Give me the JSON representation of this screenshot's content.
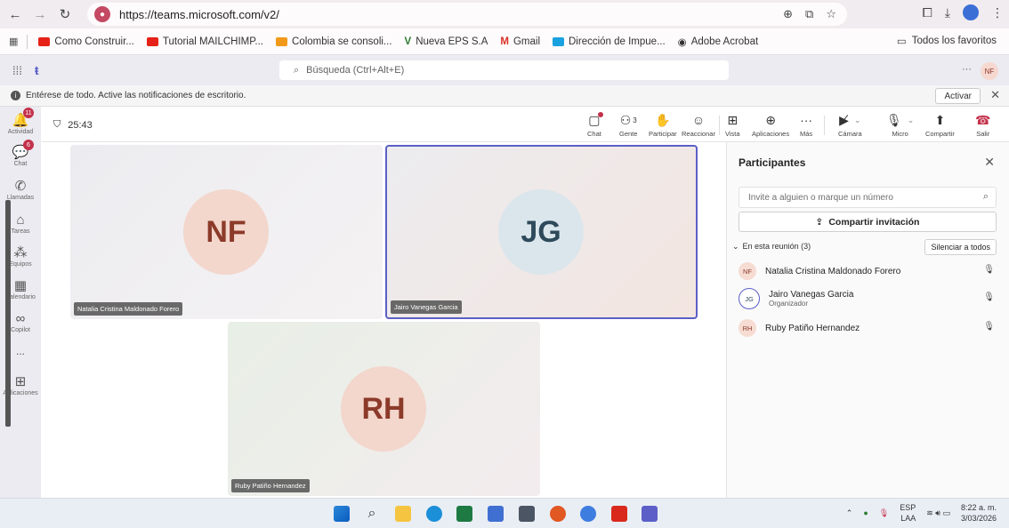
{
  "browser": {
    "url": "https://teams.microsoft.com/v2/",
    "bookmarks": [
      {
        "label": "Como Construir..."
      },
      {
        "label": "Tutorial MAILCHIMP..."
      },
      {
        "label": "Colombia se consoli..."
      },
      {
        "label": "Nueva EPS S.A"
      },
      {
        "label": "Gmail"
      },
      {
        "label": "Dirección de Impue..."
      },
      {
        "label": "Adobe Acrobat"
      }
    ],
    "all_favorites": "Todos los favoritos"
  },
  "teams": {
    "search_placeholder": "Búsqueda (Ctrl+Alt+E)",
    "avatar_initials": "NF"
  },
  "notification": {
    "text": "Entérese de todo. Active las notificaciones de escritorio.",
    "action": "Activar"
  },
  "rail": {
    "items": [
      {
        "label": "Actividad",
        "badge": "11"
      },
      {
        "label": "Chat",
        "badge": "6"
      },
      {
        "label": "Llamadas"
      },
      {
        "label": "Tareas"
      },
      {
        "label": "Equipos"
      },
      {
        "label": "Calendario"
      },
      {
        "label": "Copilot"
      },
      {
        "label": "..."
      },
      {
        "label": "Aplicaciones"
      }
    ]
  },
  "meeting": {
    "timer": "25:43",
    "people_count": "3",
    "toolbar": {
      "chat": "Chat",
      "people": "Gente",
      "raise": "Participar",
      "react": "Reaccionar",
      "view": "Vista",
      "apps": "Aplicaciones",
      "more": "Más",
      "camera": "Cámara",
      "mic": "Micro",
      "share": "Compartir",
      "leave": "Salir"
    },
    "tiles": [
      {
        "initials": "NF",
        "name": "Natalia Cristina Maldonado Forero"
      },
      {
        "initials": "JG",
        "name": "Jairo Vanegas Garcia"
      },
      {
        "initials": "RH",
        "name": "Ruby Patiño Hernandez"
      }
    ]
  },
  "panel": {
    "title": "Participantes",
    "invite_placeholder": "Invite a alguien o marque un número",
    "share_invite": "Compartir invitación",
    "in_meeting": "En esta reunión (3)",
    "mute_all": "Silenciar a todos",
    "participants": [
      {
        "initials": "NF",
        "name": "Natalia Cristina Maldonado Forero",
        "role": ""
      },
      {
        "initials": "JG",
        "name": "Jairo Vanegas Garcia",
        "role": "Organizador"
      },
      {
        "initials": "RH",
        "name": "Ruby Patiño Hernandez",
        "role": ""
      }
    ]
  },
  "taskbar": {
    "lang_top": "ESP",
    "lang_bottom": "LAA",
    "time": "8:22 a. m.",
    "date": "3/03/2026"
  }
}
